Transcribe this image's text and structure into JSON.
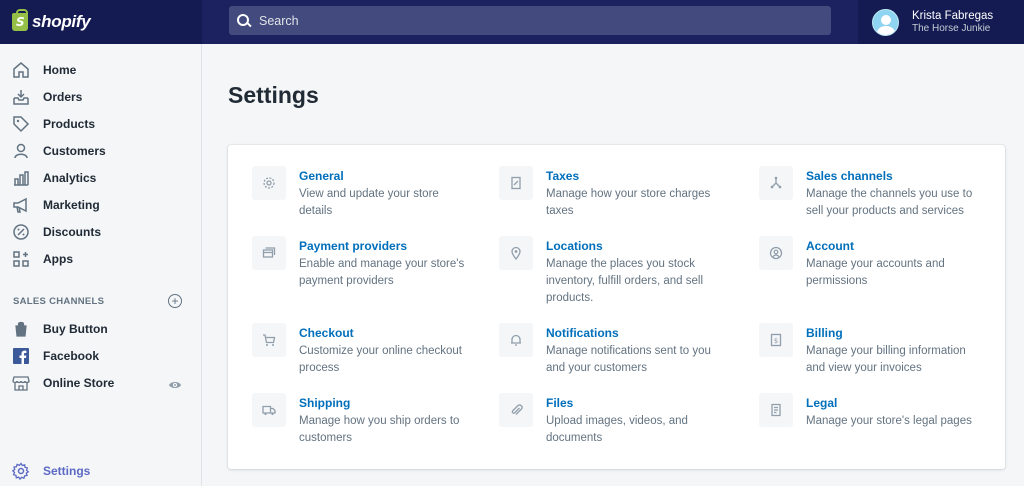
{
  "brand": {
    "logo_text": "shopify",
    "logo_letter": "S"
  },
  "search": {
    "placeholder": "Search"
  },
  "user": {
    "name": "Krista Fabregas",
    "store": "The Horse Junkie"
  },
  "sidebar": {
    "items": [
      {
        "label": "Home",
        "icon": "home-icon"
      },
      {
        "label": "Orders",
        "icon": "orders-icon"
      },
      {
        "label": "Products",
        "icon": "tag-icon"
      },
      {
        "label": "Customers",
        "icon": "person-icon"
      },
      {
        "label": "Analytics",
        "icon": "bar-chart-icon"
      },
      {
        "label": "Marketing",
        "icon": "megaphone-icon"
      },
      {
        "label": "Discounts",
        "icon": "discount-icon"
      },
      {
        "label": "Apps",
        "icon": "apps-icon"
      }
    ],
    "sales_channels_label": "SALES CHANNELS",
    "channels": [
      {
        "label": "Buy Button",
        "icon": "buy-button-icon"
      },
      {
        "label": "Facebook",
        "icon": "facebook-icon"
      },
      {
        "label": "Online Store",
        "icon": "store-icon"
      }
    ],
    "settings_label": "Settings"
  },
  "main": {
    "title": "Settings",
    "settings": [
      {
        "title": "General",
        "desc": "View and update your store details",
        "icon": "gear-icon"
      },
      {
        "title": "Taxes",
        "desc": "Manage how your store charges taxes",
        "icon": "receipt-icon"
      },
      {
        "title": "Sales channels",
        "desc": "Manage the channels you use to sell your products and services",
        "icon": "channels-icon"
      },
      {
        "title": "Payment providers",
        "desc": "Enable and manage your store's payment providers",
        "icon": "payment-icon"
      },
      {
        "title": "Locations",
        "desc": "Manage the places you stock inventory, fulfill orders, and sell products.",
        "icon": "location-pin-icon"
      },
      {
        "title": "Account",
        "desc": "Manage your accounts and permissions",
        "icon": "account-icon"
      },
      {
        "title": "Checkout",
        "desc": "Customize your online checkout process",
        "icon": "cart-icon"
      },
      {
        "title": "Notifications",
        "desc": "Manage notifications sent to you and your customers",
        "icon": "bell-icon"
      },
      {
        "title": "Billing",
        "desc": "Manage your billing information and view your invoices",
        "icon": "billing-icon"
      },
      {
        "title": "Shipping",
        "desc": "Manage how you ship orders to customers",
        "icon": "truck-icon"
      },
      {
        "title": "Files",
        "desc": "Upload images, videos, and documents",
        "icon": "paperclip-icon"
      },
      {
        "title": "Legal",
        "desc": "Manage your store's legal pages",
        "icon": "legal-icon"
      }
    ]
  },
  "colors": {
    "topbar": "#1c2260",
    "link": "#006fbb",
    "settings_active": "#5c6ac4"
  }
}
